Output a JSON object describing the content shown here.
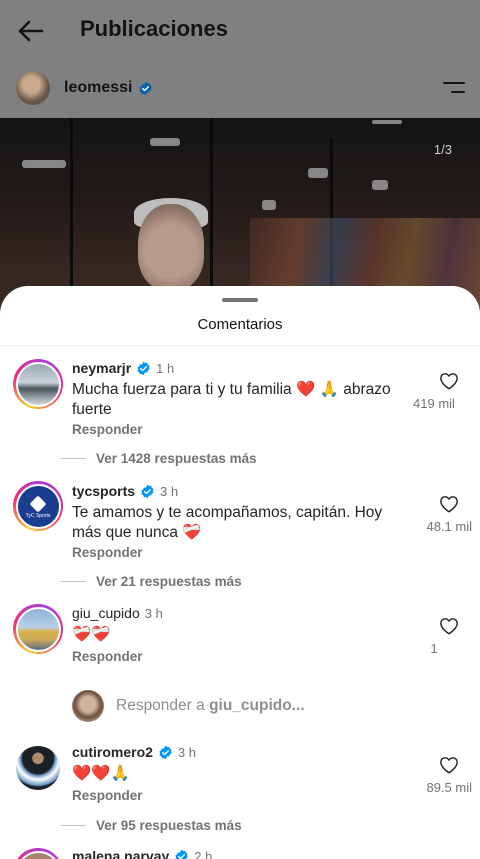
{
  "header": {
    "title": "Publicaciones",
    "back_icon": "arrow-left-icon"
  },
  "profile": {
    "username": "leomessi",
    "verified": true,
    "menu_icon": "menu-icon"
  },
  "post": {
    "page_indicator": "1/3"
  },
  "sheet": {
    "title": "Comentarios"
  },
  "comments": [
    {
      "username": "neymarjr",
      "verified": true,
      "time": "1 h",
      "text": "Mucha fuerza para ti y tu familia ❤️ 🙏 abrazo fuerte",
      "reply_label": "Responder",
      "likes": "419 mil",
      "more_replies": "Ver 1428 respuestas más"
    },
    {
      "username": "tycsports",
      "verified": true,
      "time": "3 h",
      "text": "Te amamos y te acompañamos, capitán. Hoy más que nunca ❤️‍🩹",
      "reply_label": "Responder",
      "likes": "48.1 mil",
      "more_replies": "Ver 21 respuestas más",
      "avatar_label": "TyC Sports"
    },
    {
      "username": "giu_cupido",
      "verified": false,
      "time": "3 h",
      "text": "❤️‍🩹❤️‍🩹",
      "reply_label": "Responder",
      "likes": "1"
    },
    {
      "username": "cutiromero2",
      "verified": true,
      "time": "3 h",
      "text": "❤️❤️🙏",
      "reply_label": "Responder",
      "likes": "89.5 mil",
      "more_replies": "Ver 95 respuestas más"
    },
    {
      "username": "malena.narvay",
      "verified": true,
      "time": "2 h"
    }
  ],
  "reply_box": {
    "prefix": "Responder a ",
    "target": "giu_cupido..."
  },
  "colors": {
    "accent_verified": "#0095f6",
    "story_ring_start": "#f9ce34",
    "story_ring_end": "#ee2a7b",
    "tyc_brand": "#1a3d8f"
  }
}
